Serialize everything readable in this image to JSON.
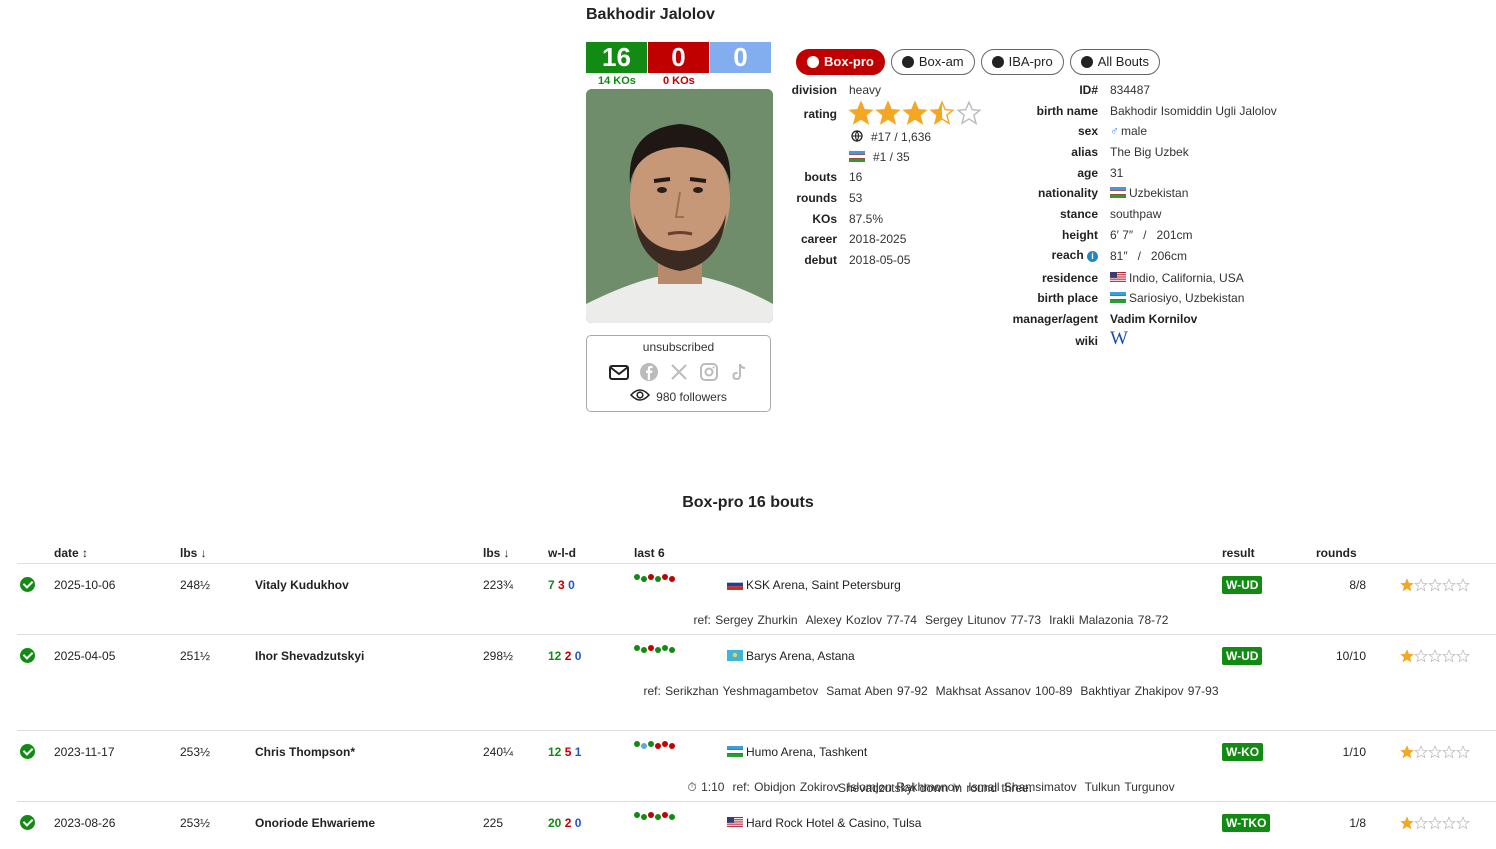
{
  "boxer": {
    "name": "Bakhodir Jalolov",
    "record": {
      "wins": "16",
      "losses": "0",
      "draws": "0",
      "win_kos": "14 KOs",
      "loss_kos": "0 KOs"
    }
  },
  "subscription": {
    "status": "unsubscribed",
    "followers": "980 followers"
  },
  "tabs": [
    {
      "label": "Box-pro",
      "active": true
    },
    {
      "label": "Box-am",
      "active": false
    },
    {
      "label": "IBA-pro",
      "active": false
    },
    {
      "label": "All Bouts",
      "active": false
    }
  ],
  "stats_left": {
    "division_label": "division",
    "division": "heavy",
    "rating_label": "rating",
    "rating_stars": 3.5,
    "rating_max": 5,
    "world_rank": "#17 / 1,636",
    "national_rank": "#1 / 35",
    "bouts_label": "bouts",
    "bouts": "16",
    "rounds_label": "rounds",
    "rounds": "53",
    "kos_label": "KOs",
    "kos": "87.5%",
    "career_label": "career",
    "career": "2018-2025",
    "debut_label": "debut",
    "debut": "2018-05-05"
  },
  "stats_right": {
    "id_label": "ID#",
    "id": "834487",
    "birth_name_label": "birth name",
    "birth_name": "Bakhodir Isomiddin Ugli Jalolov",
    "sex_label": "sex",
    "sex": "male",
    "alias_label": "alias",
    "alias": "The Big Uzbek",
    "age_label": "age",
    "age": "31",
    "nationality_label": "nationality",
    "nationality": "Uzbekistan",
    "stance_label": "stance",
    "stance": "southpaw",
    "height_label": "height",
    "height": "6′ 7″   /   201cm",
    "reach_label": "reach",
    "reach": "81″   /   206cm",
    "residence_label": "residence",
    "residence": "Indio, California, USA",
    "birth_place_label": "birth place",
    "birth_place": "Sariosiyo, Uzbekistan",
    "manager_label": "manager/agent",
    "manager": "Vadim Kornilov",
    "wiki_label": "wiki",
    "wiki_glyph": "W"
  },
  "bouts_section": {
    "title": "Box-pro 16 bouts",
    "headers": {
      "date": "date ↕",
      "lbs1": "lbs ↓",
      "lbs2": "lbs ↓",
      "wld": "w-l-d",
      "last6": "last 6",
      "result": "result",
      "rounds": "rounds"
    }
  },
  "bouts": [
    {
      "date": "2025-10-06",
      "lbs": "248½",
      "opponent": "Vitaly Kudukhov",
      "opp_lbs": "223¾",
      "w": "7",
      "l": "3",
      "d": "0",
      "last6": [
        "g",
        "g",
        "r",
        "g",
        "r",
        "r"
      ],
      "venue": "KSK Arena, Saint Petersburg",
      "flag": "ru",
      "result": "W-UD",
      "rounds": "8/8",
      "stars": 1,
      "details": [
        "ref: Sergey Zhurkin",
        "Alexey Kozlov 77-74",
        "Sergey Litunov 77-73",
        "Irakli Malazonia 78-72"
      ],
      "note": ""
    },
    {
      "date": "2025-04-05",
      "lbs": "251½",
      "opponent": "Ihor Shevadzutskyi",
      "opp_lbs": "298½",
      "w": "12",
      "l": "2",
      "d": "0",
      "last6": [
        "g",
        "g",
        "r",
        "g",
        "g",
        "g"
      ],
      "venue": "Barys Arena, Astana",
      "flag": "kz",
      "result": "W-UD",
      "rounds": "10/10",
      "stars": 1,
      "details": [
        "ref: Serikzhan Yeshmagambetov",
        "Samat Aben 97-92",
        "Makhsat Assanov 100-89",
        "Bakhtiyar Zhakipov 97-93"
      ],
      "note": "Shevadzutskyi down in round three."
    },
    {
      "date": "2023-11-17",
      "lbs": "253½",
      "opponent": "Chris Thompson*",
      "opp_lbs": "240¼",
      "w": "12",
      "l": "5",
      "d": "1",
      "last6": [
        "g",
        "b",
        "g",
        "r",
        "r",
        "r"
      ],
      "venue": "Humo Arena, Tashkent",
      "flag": "uz",
      "result": "W-KO",
      "rounds": "1/10",
      "stars": 1,
      "details": [
        "⏱ 1:10",
        "ref: Obidjon Zokirov",
        "Islomjon Rakhmonov",
        "Ismail Shamsimatov",
        "Tulkun Turgunov"
      ],
      "note": ""
    },
    {
      "date": "2023-08-26",
      "lbs": "253½",
      "opponent": "Onoriode Ehwarieme",
      "opp_lbs": "225",
      "w": "20",
      "l": "2",
      "d": "0",
      "last6": [
        "g",
        "g",
        "r",
        "g",
        "r",
        "g"
      ],
      "venue": "Hard Rock Hotel & Casino, Tulsa",
      "flag": "us",
      "result": "W-TKO",
      "rounds": "1/8",
      "stars": 1,
      "details": [],
      "note": ""
    }
  ],
  "colors": {
    "win": "#138a14",
    "loss": "#c00000",
    "draw": "#82aef0",
    "star": "#f5a623"
  }
}
